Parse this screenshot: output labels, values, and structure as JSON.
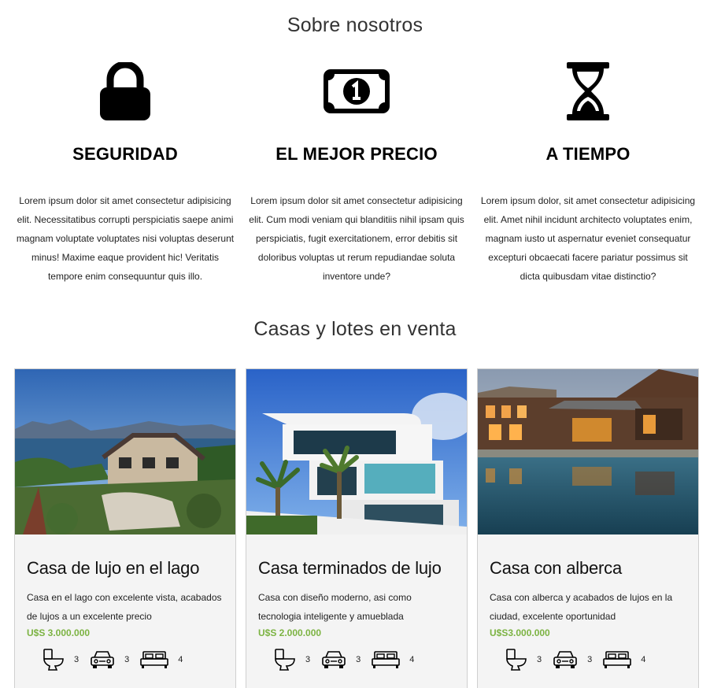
{
  "about": {
    "title": "Sobre nosotros",
    "features": [
      {
        "icon": "lock-icon",
        "title": "SEGURIDAD",
        "text": "Lorem ipsum dolor sit amet consectetur adipisicing elit. Necessitatibus corrupti perspiciatis saepe animi magnam voluptate voluptates nisi voluptas deserunt minus! Maxime eaque provident hic! Veritatis tempore enim consequuntur quis illo."
      },
      {
        "icon": "money-bill-icon",
        "title": "EL MEJOR PRECIO",
        "text": "Lorem ipsum dolor sit amet consectetur adipisicing elit. Cum modi veniam qui blanditiis nihil ipsam quis perspiciatis, fugit exercitationem, error debitis sit doloribus voluptas ut rerum repudiandae soluta inventore unde?"
      },
      {
        "icon": "hourglass-icon",
        "title": "A TIEMPO",
        "text": "Lorem ipsum dolor, sit amet consectetur adipisicing elit. Amet nihil incidunt architecto voluptates enim, magnam iusto ut aspernatur eveniet consequatur excepturi obcaecati facere pariatur possimus sit dicta quibusdam vitae distinctio?"
      }
    ]
  },
  "listings": {
    "title": "Casas y lotes en venta",
    "cards": [
      {
        "photo": "lake-house-photo",
        "title": "Casa de lujo en el lago",
        "description": "Casa en el lago con excelente vista, acabados de lujos a un excelente precio",
        "price": "U$S 3.000.000",
        "bathrooms": "3",
        "parking": "3",
        "bedrooms": "4"
      },
      {
        "photo": "modern-house-photo",
        "title": "Casa terminados de lujo",
        "description": "Casa con diseño moderno, asi como tecnologia inteligente y amueblada",
        "price": "U$S 2.000.000",
        "bathrooms": "3",
        "parking": "3",
        "bedrooms": "4"
      },
      {
        "photo": "pool-house-photo",
        "title": "Casa con alberca",
        "description": "Casa con alberca y acabados de lujos en la ciudad, excelente oportunidad",
        "price": "U$S3.000.000",
        "bathrooms": "3",
        "parking": "3",
        "bedrooms": "4"
      }
    ]
  },
  "colors": {
    "price": "#7cb342",
    "card_background": "#f4f4f4",
    "title_text": "#333333"
  }
}
